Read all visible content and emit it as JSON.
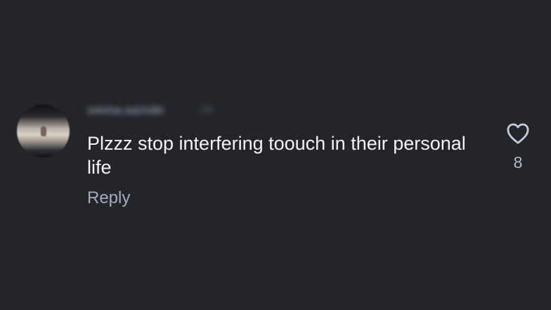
{
  "comment": {
    "username": "veena.sarode",
    "timestamp": "8h",
    "text": "Plzzz stop interfering toouch in their personal life",
    "reply_label": "Reply",
    "like_count": "8",
    "like_icon": "heart-outline-icon"
  },
  "colors": {
    "background": "#23252b",
    "primary_text": "#f2f4f7",
    "secondary_text": "#a7acb5"
  }
}
